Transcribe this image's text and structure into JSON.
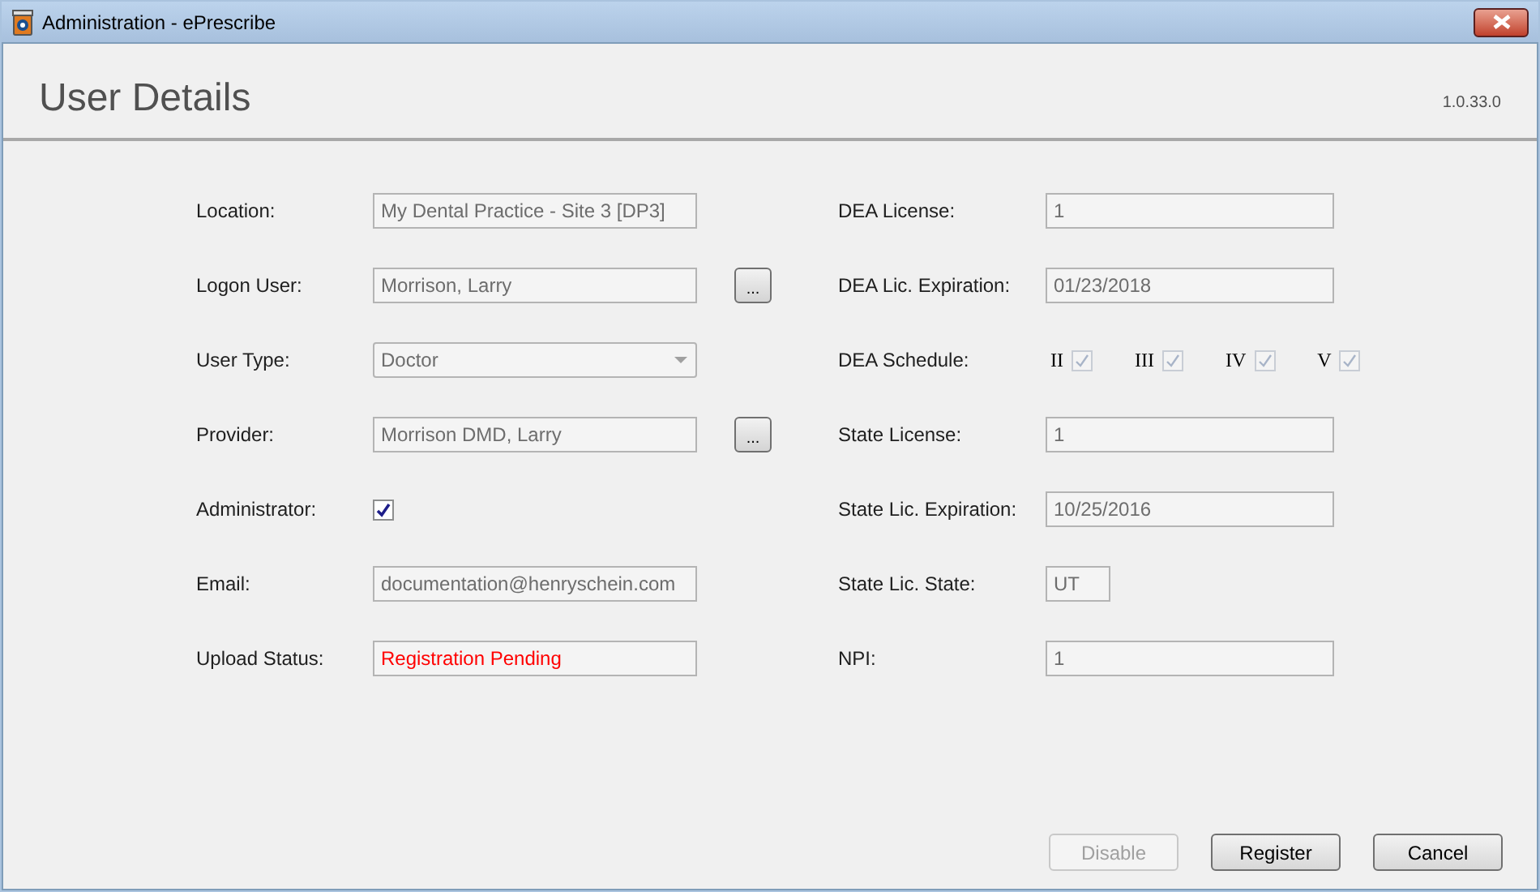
{
  "window": {
    "title": "Administration - ePrescribe"
  },
  "header": {
    "title": "User Details",
    "version": "1.0.33.0"
  },
  "left_fields": [
    {
      "kind": "text",
      "label": "Location:",
      "value": "My Dental Practice - Site 3 [DP3]"
    },
    {
      "kind": "browse",
      "label": "Logon User:",
      "value": "Morrison, Larry",
      "button": "..."
    },
    {
      "kind": "dropdown",
      "label": "User Type:",
      "value": "Doctor"
    },
    {
      "kind": "browse",
      "label": "Provider:",
      "value": "Morrison DMD, Larry",
      "button": "..."
    },
    {
      "kind": "checkbox",
      "label": "Administrator:",
      "checked": true
    },
    {
      "kind": "text",
      "label": "Email:",
      "value": "documentation@henryschein.com"
    },
    {
      "kind": "status",
      "label": "Upload Status:",
      "value": "Registration Pending"
    }
  ],
  "right_fields": [
    {
      "kind": "text",
      "label": "DEA License:",
      "value": "1"
    },
    {
      "kind": "text",
      "label": "DEA Lic. Expiration:",
      "value": "01/23/2018"
    },
    {
      "kind": "schedule",
      "label": "DEA Schedule:",
      "options": [
        {
          "label": "II",
          "checked": true
        },
        {
          "label": "III",
          "checked": true
        },
        {
          "label": "IV",
          "checked": true
        },
        {
          "label": "V",
          "checked": true
        }
      ]
    },
    {
      "kind": "text",
      "label": "State License:",
      "value": "1"
    },
    {
      "kind": "text",
      "label": "State Lic. Expiration:",
      "value": "10/25/2016"
    },
    {
      "kind": "short",
      "label": "State Lic. State:",
      "value": "UT"
    },
    {
      "kind": "text",
      "label": "NPI:",
      "value": "1"
    }
  ],
  "buttons": [
    {
      "label": "Disable",
      "disabled": true
    },
    {
      "label": "Register",
      "disabled": false
    },
    {
      "label": "Cancel",
      "disabled": false
    }
  ]
}
